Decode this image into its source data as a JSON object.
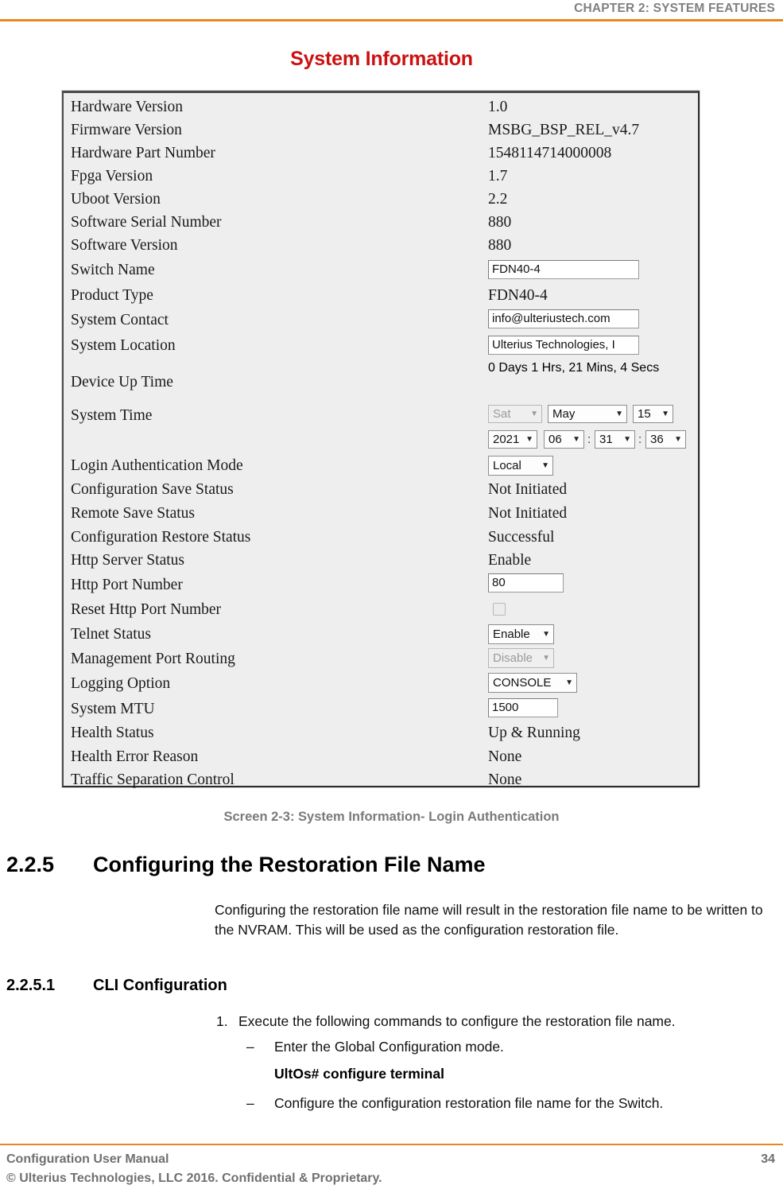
{
  "header": {
    "chapter": "CHAPTER 2: SYSTEM FEATURES",
    "rule_color": "#e8871f"
  },
  "figure": {
    "title": "System Information",
    "title_color": "#cc1111",
    "caption": "Screen 2-3: System Information- Login Authentication",
    "rows": [
      {
        "label": "Hardware Version",
        "type": "text",
        "value": "1.0"
      },
      {
        "label": "Firmware Version",
        "type": "text",
        "value": "MSBG_BSP_REL_v4.7"
      },
      {
        "label": "Hardware Part Number",
        "type": "text",
        "value": "1548114714000008"
      },
      {
        "label": "Fpga Version",
        "type": "text",
        "value": "1.7"
      },
      {
        "label": "Uboot Version",
        "type": "text",
        "value": "2.2"
      },
      {
        "label": "Software Serial Number",
        "type": "text",
        "value": "880"
      },
      {
        "label": "Software Version",
        "type": "text",
        "value": "880"
      },
      {
        "label": "Switch Name",
        "type": "input",
        "value": "FDN40-4"
      },
      {
        "label": "Product Type",
        "type": "text",
        "value": "FDN40-4"
      },
      {
        "label": "System Contact",
        "type": "input",
        "value": "info@ulteriustech.com"
      },
      {
        "label": "System Location",
        "type": "input",
        "value": "Ulterius Technologies, I"
      },
      {
        "label": "Device Up Time",
        "type": "text",
        "value": "0 Days 1 Hrs, 21 Mins, 4 Secs"
      },
      {
        "label": "System Time",
        "type": "datetime",
        "value": ""
      },
      {
        "label": "Login Authentication Mode",
        "type": "select",
        "value": "Local"
      },
      {
        "label": "Configuration Save Status",
        "type": "text",
        "value": "Not Initiated"
      },
      {
        "label": "Remote Save Status",
        "type": "text",
        "value": "Not Initiated"
      },
      {
        "label": "Configuration Restore Status",
        "type": "text",
        "value": "Successful"
      },
      {
        "label": "Http Server Status",
        "type": "text",
        "value": "Enable"
      },
      {
        "label": "Http Port Number",
        "type": "input",
        "value": "80"
      },
      {
        "label": "Reset Http Port Number",
        "type": "checkbox",
        "value": ""
      },
      {
        "label": "Telnet Status",
        "type": "select",
        "value": "Enable"
      },
      {
        "label": "Management Port Routing",
        "type": "select-disabled",
        "value": "Disable"
      },
      {
        "label": "Logging Option",
        "type": "select",
        "value": "CONSOLE"
      },
      {
        "label": "System MTU",
        "type": "input",
        "value": "1500"
      },
      {
        "label": "Health Status",
        "type": "text",
        "value": "Up & Running"
      },
      {
        "label": "Health Error Reason",
        "type": "text",
        "value": "None"
      },
      {
        "label": "Traffic Separation Control",
        "type": "text",
        "value": "None"
      }
    ],
    "system_time": {
      "weekday": "Sat",
      "month": "May",
      "day": "15",
      "year": "2021",
      "hour": "06",
      "minute": "31",
      "second": "36",
      "separator": ":"
    }
  },
  "section": {
    "number": "2.2.5",
    "title": "Configuring the Restoration File Name",
    "paragraph": "Configuring the restoration file name will result in the restoration file name to be written to the NVRAM. This will be used as the configuration restoration file.",
    "sub_number": "2.2.5.1",
    "sub_title": "CLI Configuration",
    "step_number": "1.",
    "step_text": "Execute the following commands to configure the restoration file name.",
    "bullet_1_mark": "–",
    "bullet_1_text": "Enter the Global Configuration mode.",
    "cli_command": "UltOs# configure terminal",
    "bullet_2_mark": "–",
    "bullet_2_text": "Configure the configuration restoration file name for the Switch."
  },
  "footer": {
    "line1": "Configuration User Manual",
    "line2": "© Ulterius Technologies, LLC 2016. Confidential & Proprietary.",
    "page": "34"
  }
}
